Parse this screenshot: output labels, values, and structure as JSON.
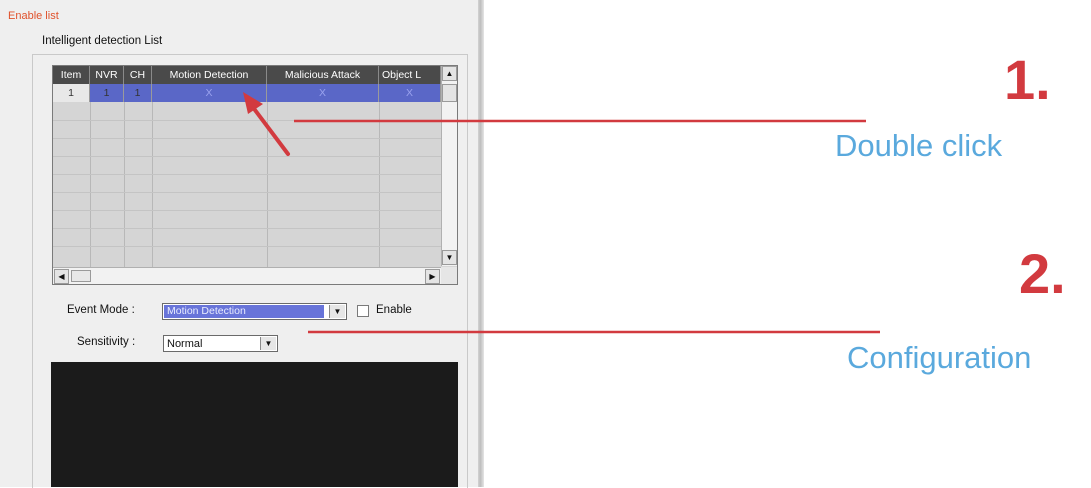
{
  "dialog": {
    "enable_list_label": "Enable list",
    "group_title": "Intelligent detection List",
    "table": {
      "columns": [
        "Item",
        "NVR",
        "CH",
        "Motion Detection",
        "Malicious Attack",
        "Object L"
      ],
      "rows": [
        [
          "1",
          "1",
          "1",
          "X",
          "X",
          "X"
        ]
      ]
    },
    "scroll_icons": {
      "up": "arrow-up-icon",
      "down": "arrow-down-icon",
      "left": "arrow-left-icon",
      "right": "arrow-right-icon"
    },
    "event_mode": {
      "label": "Event Mode :",
      "value": "Motion Detection"
    },
    "enable_checkbox": {
      "label": "Enable",
      "checked": false
    },
    "sensitivity": {
      "label": "Sensitivity :",
      "value": "Normal"
    }
  },
  "annotations": {
    "step1_number": "1.",
    "step1_text": "Double click",
    "step2_number": "2.",
    "step2_text": "Configuration",
    "accent_color": "#d23a3f",
    "text_color": "#5aa9dd"
  }
}
